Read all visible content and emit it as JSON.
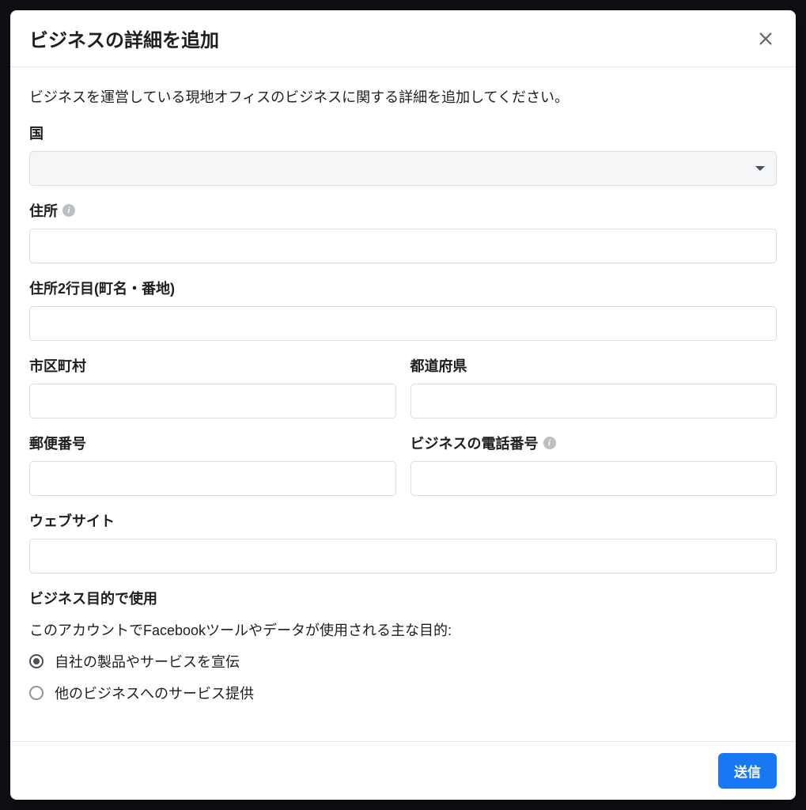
{
  "modal": {
    "title": "ビジネスの詳細を追加",
    "intro": "ビジネスを運営している現地オフィスのビジネスに関する詳細を追加してください。"
  },
  "fields": {
    "country": {
      "label": "国",
      "value": ""
    },
    "address": {
      "label": "住所",
      "value": ""
    },
    "address2": {
      "label": "住所2行目(町名・番地)",
      "value": ""
    },
    "city": {
      "label": "市区町村",
      "value": ""
    },
    "state": {
      "label": "都道府県",
      "value": ""
    },
    "postal": {
      "label": "郵便番号",
      "value": ""
    },
    "phone": {
      "label": "ビジネスの電話番号",
      "value": ""
    },
    "website": {
      "label": "ウェブサイト",
      "value": ""
    }
  },
  "purpose": {
    "heading": "ビジネス目的で使用",
    "subtext": "このアカウントでFacebookツールやデータが使用される主な目的:",
    "options": [
      {
        "label": "自社の製品やサービスを宣伝",
        "checked": true
      },
      {
        "label": "他のビジネスへのサービス提供",
        "checked": false
      }
    ]
  },
  "footer": {
    "submit": "送信"
  }
}
